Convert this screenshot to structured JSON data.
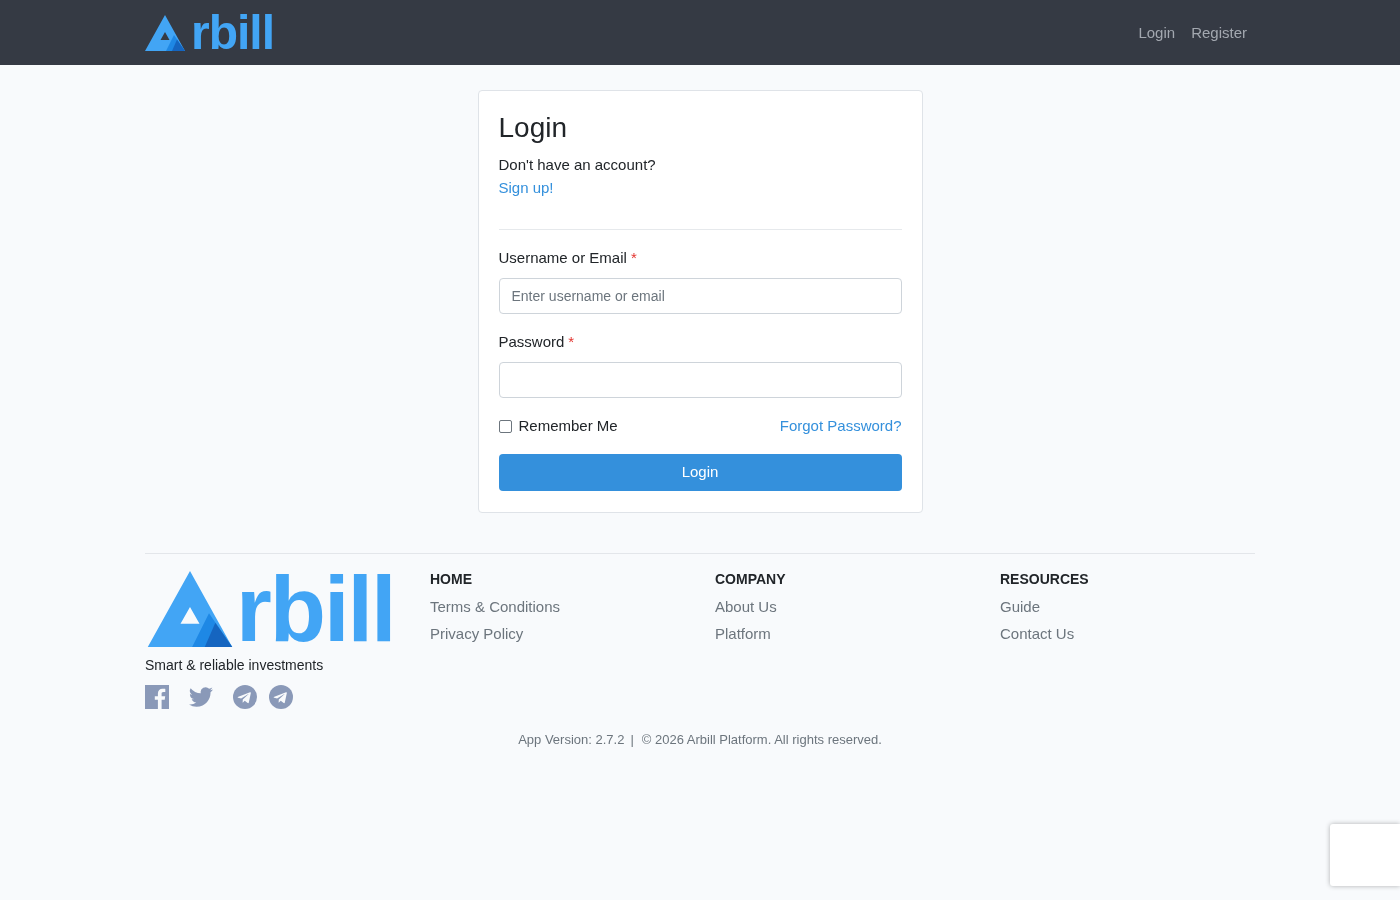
{
  "header": {
    "logo": {
      "text": "rbill"
    },
    "nav": [
      {
        "label": "Login"
      },
      {
        "label": "Register"
      }
    ]
  },
  "login_card": {
    "title": "Login",
    "prompt": "Don't have an account?",
    "signup_link": "Sign up!",
    "fields": [
      {
        "label": "Username or Email",
        "required_mark": "*",
        "placeholder": "Enter username or email"
      },
      {
        "label": "Password",
        "required_mark": "*"
      }
    ],
    "remember": {
      "label": "Remember Me",
      "checked": false
    },
    "forgot_link": "Forgot Password?",
    "submit": "Login"
  },
  "footer": {
    "logo": {
      "text": "rbill"
    },
    "tagline": "Smart & reliable investments",
    "social": [
      {
        "kind": "facebook"
      },
      {
        "kind": "twitter"
      },
      {
        "kind": "telegram"
      },
      {
        "kind": "telegram"
      }
    ],
    "columns": [
      {
        "heading": "HOME",
        "links": [
          "Terms & Conditions",
          "Privacy Policy"
        ]
      },
      {
        "heading": "COMPANY",
        "links": [
          "About Us",
          "Platform"
        ]
      },
      {
        "heading": "RESOURCES",
        "links": [
          "Guide",
          "Contact Us"
        ]
      }
    ],
    "version": "App Version: 2.7.2",
    "separator": "|",
    "copyright": "© 2026 Arbill Platform. All rights reserved."
  }
}
